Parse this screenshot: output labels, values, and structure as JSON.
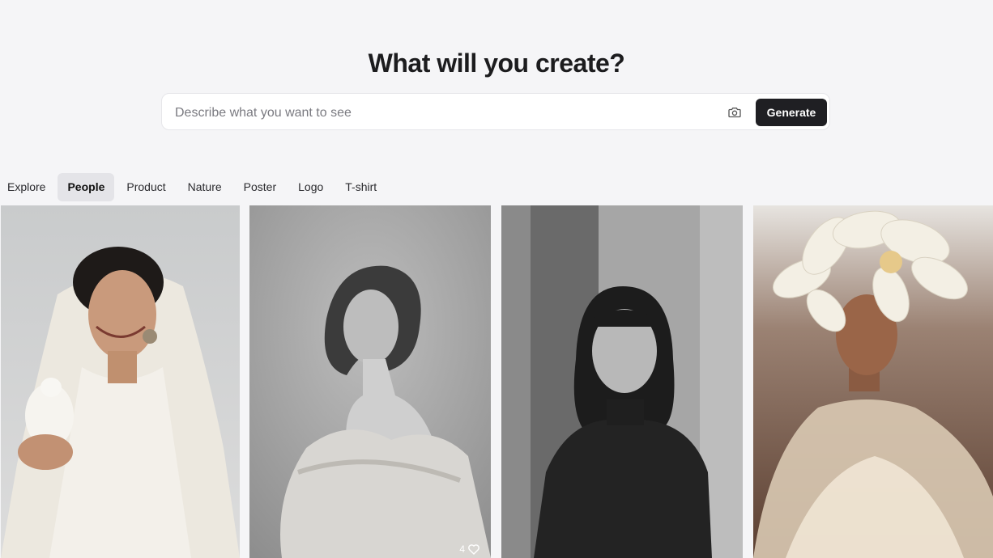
{
  "header": {
    "title": "What will you create?"
  },
  "search": {
    "placeholder": "Describe what you want to see",
    "value": "",
    "camera_icon": "camera-icon",
    "generate_label": "Generate"
  },
  "tabs": [
    {
      "label": "Explore",
      "active": false
    },
    {
      "label": "People",
      "active": true
    },
    {
      "label": "Product",
      "active": false
    },
    {
      "label": "Nature",
      "active": false
    },
    {
      "label": "Poster",
      "active": false
    },
    {
      "label": "Logo",
      "active": false
    },
    {
      "label": "T-shirt",
      "active": false
    }
  ],
  "gallery": {
    "cards": [
      {
        "subject": "woman in white veil holding a dove"
      },
      {
        "subject": "black and white portrait, short bob, off-shoulder knit",
        "likes": "4",
        "like_icon": "heart-icon"
      },
      {
        "subject": "black and white portrait, bangs, black turtleneck"
      },
      {
        "subject": "woman with large white flower headpiece, tulle dress"
      }
    ]
  },
  "colors": {
    "background": "#f5f5f7",
    "button": "#1f1f23",
    "active_tab": "#e4e4e8"
  }
}
